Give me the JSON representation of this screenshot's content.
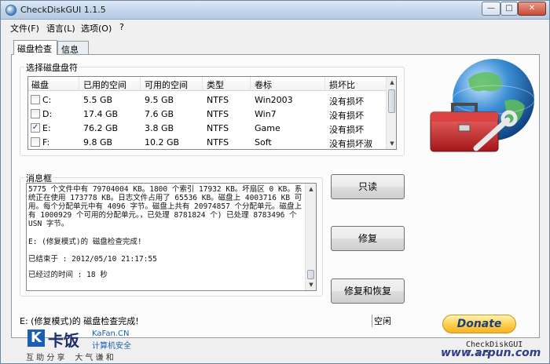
{
  "window": {
    "title": "CheckDiskGUI 1.1.5",
    "minimize": "0",
    "maximize": "1",
    "close": "r"
  },
  "menu": [
    "文件(F)",
    "语言(L)",
    "选项(O)",
    "?"
  ],
  "tabs": [
    "磁盘检查",
    "信息"
  ],
  "disk_group": {
    "label": "选择磁盘盘符"
  },
  "disk_table": {
    "columns": [
      "磁盘",
      "已用的空间",
      "可用的空间",
      "类型",
      "卷标",
      "损坏比"
    ],
    "rows": [
      {
        "drive": "C:",
        "used": "5.5 GB",
        "free": "9.5 GB",
        "type": "NTFS",
        "label": "Win2003",
        "status": "没有损坏",
        "checked": false
      },
      {
        "drive": "D:",
        "used": "17.4 GB",
        "free": "7.6 GB",
        "type": "NTFS",
        "label": "Win7",
        "status": "没有损坏",
        "checked": false
      },
      {
        "drive": "E:",
        "used": "76.2 GB",
        "free": "3.8 GB",
        "type": "NTFS",
        "label": "Game",
        "status": "没有损坏",
        "checked": true
      },
      {
        "drive": "F:",
        "used": "9.8 GB",
        "free": "10.2 GB",
        "type": "NTFS",
        "label": "Soft",
        "status": "没有损坏淑",
        "checked": false
      }
    ]
  },
  "message_group": {
    "label": "消息框"
  },
  "messages": {
    "log": "5775 个文件中有 79704004 KB。1800 个索引 17932 KB。坏扇区 0 KB。系统正在使用 173778 KB。日志文件占用了 65536 KB。磁盘上 4003716 KB 可用。每个分配单元中有 4096 字节。磁盘上共有 20974857 个分配单元。磁盘上有 1000929 个可用的分配单元。，已处理 8781824 个) 已处理 8783496 个 USN 字节。",
    "complete": "E: (修复模式)的 磁盘检查完成!",
    "ended": "已结束于 : 2012/05/10 21:17:55",
    "elapsed": "已经过的时间 : 18 秒"
  },
  "buttons": {
    "readonly": "只读",
    "repair": "修复",
    "repair_recover": "修复和恢复"
  },
  "status": {
    "text": "E: (修复模式)的 磁盘检查完成!",
    "right": "空闲"
  },
  "donate": "Donate",
  "version": "CheckDiskGUI 1.1.5",
  "watermark": {
    "brand": "卡饭",
    "site": "KaFan.CN",
    "tagline": "计算机安全",
    "motto": "互 助 分 享    大 气 谦 和",
    "right": "www.arpun.com"
  }
}
